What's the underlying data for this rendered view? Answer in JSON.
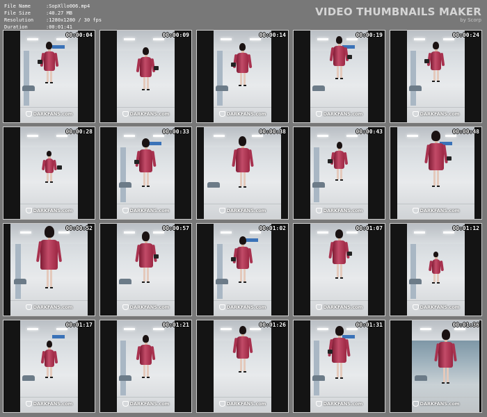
{
  "file_info": [
    {
      "label": "File Name",
      "value": "SopXllo006.mp4"
    },
    {
      "label": "File Size",
      "value": "40.27 MB"
    },
    {
      "label": "Resolution",
      "value": "1280x1280 / 30 fps"
    },
    {
      "label": "Duration",
      "value": "00:01:41"
    }
  ],
  "brand": {
    "title": "VIDEO THUMBNAILS MAKER",
    "subtitle": "by Scorp"
  },
  "watermark": "DARKFANS.com",
  "thumbnails": [
    {
      "time": "00:00:04"
    },
    {
      "time": "00:00:09"
    },
    {
      "time": "00:00:14"
    },
    {
      "time": "00:00:19"
    },
    {
      "time": "00:00:24"
    },
    {
      "time": "00:00:28"
    },
    {
      "time": "00:00:33"
    },
    {
      "time": "00:00:38"
    },
    {
      "time": "00:00:43"
    },
    {
      "time": "00:00:48"
    },
    {
      "time": "00:00:52"
    },
    {
      "time": "00:00:57"
    },
    {
      "time": "00:01:02"
    },
    {
      "time": "00:01:07"
    },
    {
      "time": "00:01:12"
    },
    {
      "time": "00:01:17"
    },
    {
      "time": "00:01:21"
    },
    {
      "time": "00:01:26"
    },
    {
      "time": "00:01:31"
    },
    {
      "time": "00:01:36"
    }
  ]
}
